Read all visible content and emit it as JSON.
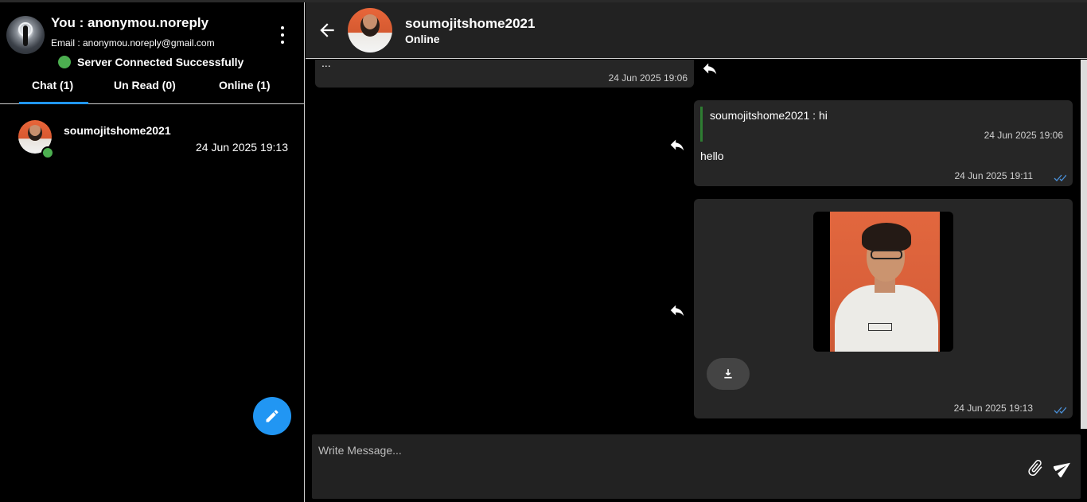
{
  "profile": {
    "name": "You : anonymou.noreply",
    "email": "Email : anonymou.noreply@gmail.com",
    "server_status": "Server Connected Successfully"
  },
  "tabs": [
    {
      "label": "Chat (1)",
      "active": true
    },
    {
      "label": "Un Read (0)",
      "active": false
    },
    {
      "label": "Online (1)",
      "active": false
    }
  ],
  "chat_list": [
    {
      "name": "soumojitshome2021",
      "time": "24 Jun 2025 19:13",
      "online": true
    }
  ],
  "conversation": {
    "name": "soumojitshome2021",
    "status": "Online"
  },
  "messages": [
    {
      "direction": "in",
      "text": "...",
      "time": "24 Jun 2025 19:06"
    },
    {
      "direction": "out",
      "quote_text": "soumojitshome2021 : hi",
      "quote_time": "24 Jun 2025 19:06",
      "text": "hello",
      "time": "24 Jun 2025 19:11",
      "read": true
    },
    {
      "direction": "out",
      "type": "image",
      "time": "24 Jun 2025 19:13",
      "read": true
    }
  ],
  "composer": {
    "placeholder": "Write Message..."
  },
  "colors": {
    "accent": "#2196f3",
    "online": "#4caf50",
    "panel": "#222222",
    "bubble": "#262626"
  },
  "icons": [
    "kebab-menu-icon",
    "pencil-icon",
    "back-arrow-icon",
    "reply-icon",
    "double-check-icon",
    "download-icon",
    "paperclip-icon",
    "send-icon"
  ]
}
